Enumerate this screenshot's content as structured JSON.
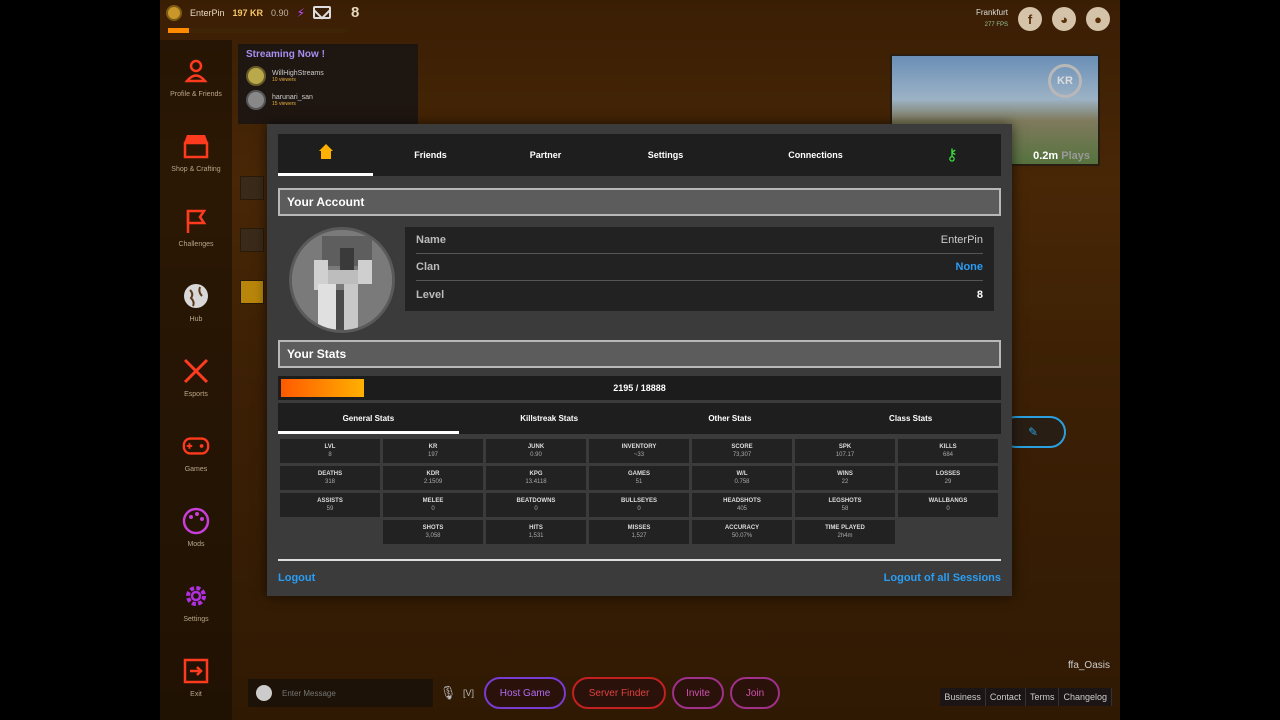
{
  "hud": {
    "username": "EnterPin",
    "kr": "197 KR",
    "junk": "0.90",
    "level": "8",
    "server_region": "Frankfurt",
    "server_fps": "277 FPS"
  },
  "sidebar": {
    "items": [
      {
        "label": "Profile & Friends",
        "icon": "profile-icon",
        "color": "#ff3b1f"
      },
      {
        "label": "Shop & Crafting",
        "icon": "shop-icon",
        "color": "#ff3b1f"
      },
      {
        "label": "Challenges",
        "icon": "flag-icon",
        "color": "#ff3b1f"
      },
      {
        "label": "Hub",
        "icon": "globe-icon",
        "color": "#d8d8d8"
      },
      {
        "label": "Esports",
        "icon": "swords-icon",
        "color": "#ff3b1f"
      },
      {
        "label": "Games",
        "icon": "gamepad-icon",
        "color": "#ff3b1f"
      },
      {
        "label": "Mods",
        "icon": "palette-icon",
        "color": "#c93dd8"
      },
      {
        "label": "Settings",
        "icon": "gear-icon",
        "color": "#b030e0"
      },
      {
        "label": "Exit",
        "icon": "exit-icon",
        "color": "#ff3b1f"
      }
    ]
  },
  "streaming": {
    "title": "Streaming Now !",
    "streams": [
      {
        "name": "WillHighStreams",
        "views": "10 viewers"
      },
      {
        "name": "harunari_san",
        "views": "15 viewers"
      }
    ]
  },
  "preview": {
    "plays_num": "0.2m",
    "plays_label": "Plays",
    "badge": "KR"
  },
  "bottom": {
    "chat_placeholder": "Enter Message",
    "hotkey": "[V]",
    "host_game": "Host Game",
    "server_finder": "Server Finder",
    "invite": "Invite",
    "join": "Join"
  },
  "map_name": "ffa_Oasis",
  "footer_links": [
    "Business",
    "Contact",
    "Terms",
    "Changelog"
  ],
  "modal": {
    "tabs": [
      "Friends",
      "Partner",
      "Settings",
      "Connections"
    ],
    "account_header": "Your Account",
    "account": {
      "name_label": "Name",
      "name_value": "EnterPin",
      "clan_label": "Clan",
      "clan_value": "None",
      "level_label": "Level",
      "level_value": "8"
    },
    "stats_header": "Your Stats",
    "xp": {
      "current": 2195,
      "max": 18888,
      "text": "2195 / 18888"
    },
    "stat_tabs": [
      "General Stats",
      "Killstreak Stats",
      "Other Stats",
      "Class Stats"
    ],
    "stats_rows": [
      [
        {
          "n": "LVL",
          "v": "8"
        },
        {
          "n": "KR",
          "v": "197"
        },
        {
          "n": "JUNK",
          "v": "0.90"
        },
        {
          "n": "INVENTORY",
          "v": "~33"
        },
        {
          "n": "SCORE",
          "v": "73,307"
        },
        {
          "n": "SPK",
          "v": "107.17"
        },
        {
          "n": "KILLS",
          "v": "684"
        }
      ],
      [
        {
          "n": "DEATHS",
          "v": "318"
        },
        {
          "n": "KDR",
          "v": "2.1509"
        },
        {
          "n": "KPG",
          "v": "13.4118"
        },
        {
          "n": "GAMES",
          "v": "51"
        },
        {
          "n": "W/L",
          "v": "0.758"
        },
        {
          "n": "WINS",
          "v": "22"
        },
        {
          "n": "LOSSES",
          "v": "29"
        }
      ],
      [
        {
          "n": "ASSISTS",
          "v": "59"
        },
        {
          "n": "MELEE",
          "v": "0"
        },
        {
          "n": "BEATDOWNS",
          "v": "0"
        },
        {
          "n": "BULLSEYES",
          "v": "0"
        },
        {
          "n": "HEADSHOTS",
          "v": "405"
        },
        {
          "n": "LEGSHOTS",
          "v": "58"
        },
        {
          "n": "WALLBANGS",
          "v": "0"
        }
      ],
      [
        {
          "n": "SHOTS",
          "v": "3,058"
        },
        {
          "n": "HITS",
          "v": "1,531"
        },
        {
          "n": "MISSES",
          "v": "1,527"
        },
        {
          "n": "ACCURACY",
          "v": "50.07%"
        },
        {
          "n": "TIME PLAYED",
          "v": "2h4m"
        }
      ]
    ],
    "logout": "Logout",
    "logout_all": "Logout of all Sessions"
  },
  "colors": {
    "accent_blue": "#2a9df4",
    "xp_orange": "#ff8a00",
    "home_gold": "#ffb000",
    "key_green": "#3ce03c"
  }
}
